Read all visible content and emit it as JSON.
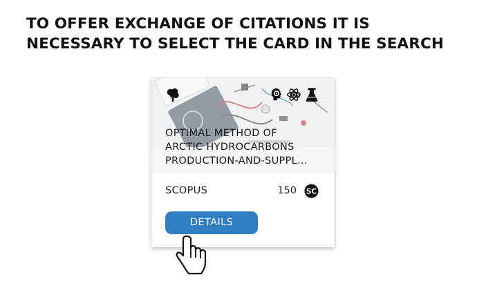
{
  "heading": {
    "line1": "TO OFFER EXCHANGE OF CITATIONS IT IS",
    "line2": "NECESSARY TO SELECT THE CARD IN THE SEARCH"
  },
  "card": {
    "title_lines": [
      "OPTIMAL METHOD OF",
      "ARCTIC HYDROCARBONS",
      "PRODUCTION-AND-SUPPL..."
    ],
    "database": "SCOPUS",
    "price": "150",
    "coin_label": "SC",
    "details_label": "DETAILS",
    "topic_icons": [
      "tree-icon",
      "brain-gear-icon",
      "atom-icon",
      "flask-icon"
    ],
    "accent_color": "#2f7ec1"
  }
}
